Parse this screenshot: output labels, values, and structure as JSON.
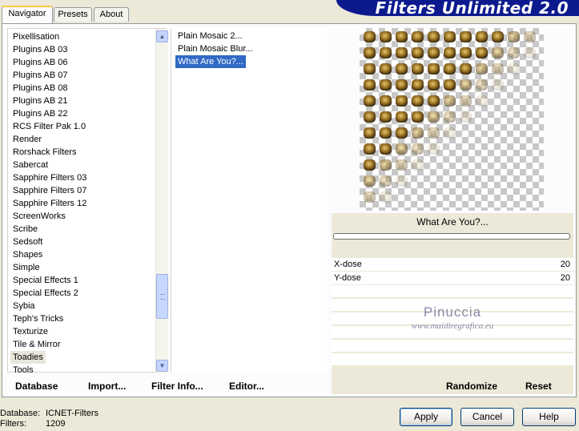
{
  "tabs": [
    {
      "label": "Navigator",
      "active": true
    },
    {
      "label": "Presets",
      "active": false
    },
    {
      "label": "About",
      "active": false
    }
  ],
  "app_title": "Filters Unlimited 2.0",
  "categories": {
    "items": [
      "Pixellisation",
      "Plugins AB 03",
      "Plugins AB 06",
      "Plugins AB 07",
      "Plugins AB 08",
      "Plugins AB 21",
      "Plugins AB 22",
      "RCS Filter Pak 1.0",
      "Render",
      "Rorshack Filters",
      "Sabercat",
      "Sapphire Filters 03",
      "Sapphire Filters 07",
      "Sapphire Filters 12",
      "ScreenWorks",
      "Scribe",
      "Sedsoft",
      "Shapes",
      "Simple",
      "Special Effects 1",
      "Special Effects 2",
      "Sybia",
      "Teph's Tricks",
      "Texturize",
      "Tile & Mirror",
      "Toadies",
      "Tools"
    ],
    "selected": "Toadies"
  },
  "filters": {
    "items": [
      "Plain Mosaic 2...",
      "Plain Mosaic Blur...",
      "What Are You?..."
    ],
    "selected": "What Are You?..."
  },
  "preview": {
    "filter_name": "What Are You?...",
    "progress": 0
  },
  "parameters": [
    {
      "label": "X-dose",
      "value": "20"
    },
    {
      "label": "Y-dose",
      "value": "20"
    }
  ],
  "watermark": {
    "line1": "Pinuccia",
    "line2": "www.maidiregrafica.eu"
  },
  "toolbar": {
    "database_label": "Database",
    "import_label": "Import...",
    "filter_info_label": "Filter Info...",
    "editor_label": "Editor...",
    "randomize_label": "Randomize",
    "reset_label": "Reset"
  },
  "status": {
    "database_label": "Database:",
    "database_value": "ICNET-Filters",
    "filters_label": "Filters:",
    "filters_value": "1209"
  },
  "buttons": {
    "apply_label": "Apply",
    "cancel_label": "Cancel",
    "help_label": "Help"
  },
  "colors": {
    "selection": "#316ac5",
    "banner": "#0c1a8e",
    "window_bg": "#ece9d8",
    "tab_highlight": "#ffc83c"
  }
}
